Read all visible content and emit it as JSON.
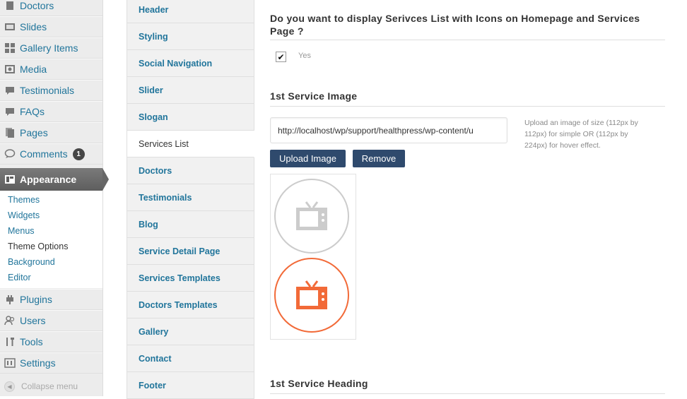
{
  "sidebar": {
    "items": [
      {
        "label": "Doctors",
        "icon": "doctors-icon"
      },
      {
        "label": "Slides",
        "icon": "slides-icon"
      },
      {
        "label": "Gallery Items",
        "icon": "gallery-icon"
      },
      {
        "label": "Media",
        "icon": "media-icon"
      },
      {
        "label": "Testimonials",
        "icon": "testimonials-icon"
      },
      {
        "label": "FAQs",
        "icon": "faqs-icon"
      },
      {
        "label": "Pages",
        "icon": "pages-icon"
      },
      {
        "label": "Comments",
        "icon": "comments-icon",
        "badge": "1"
      }
    ],
    "appearance": {
      "label": "Appearance",
      "icon": "appearance-icon"
    },
    "submenu": [
      "Themes",
      "Widgets",
      "Menus",
      "Theme Options",
      "Background",
      "Editor"
    ],
    "submenu_current": "Theme Options",
    "lower_items": [
      {
        "label": "Plugins",
        "icon": "plugins-icon"
      },
      {
        "label": "Users",
        "icon": "users-icon"
      },
      {
        "label": "Tools",
        "icon": "tools-icon"
      },
      {
        "label": "Settings",
        "icon": "settings-icon"
      }
    ],
    "collapse_label": "Collapse menu"
  },
  "tabs": {
    "items": [
      "Header",
      "Styling",
      "Social Navigation",
      "Slider",
      "Slogan",
      "Services List",
      "Doctors",
      "Testimonials",
      "Blog",
      "Service Detail Page",
      "Services Templates",
      "Doctors Templates",
      "Gallery",
      "Contact",
      "Footer"
    ],
    "active": "Services List"
  },
  "content": {
    "question_heading": "Do you want to display Serivces List with Icons on Homepage and Services Page ?",
    "checkbox_label": "Yes",
    "checkbox_checked": true,
    "image_heading": "1st Service Image",
    "url_value": "http://localhost/wp/support/healthpress/wp-content/u",
    "hint": "Upload an image of size (112px by 112px) for simple OR (112px by 224px) for hover effect.",
    "upload_label": "Upload Image",
    "remove_label": "Remove",
    "preview_icon": "tv-icon",
    "next_heading": "1st Service Heading"
  },
  "colors": {
    "link": "#21759b",
    "button": "#2f4a6d",
    "icon_gray": "#cccccc",
    "icon_orange": "#f26a38"
  }
}
